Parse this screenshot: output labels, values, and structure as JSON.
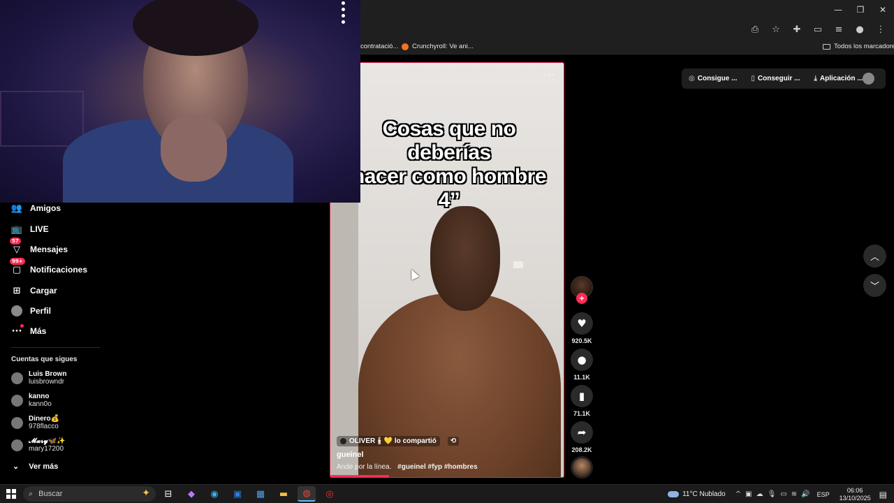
{
  "browser": {
    "bookmarks": {
      "item1": "contratació...",
      "item2": "Crunchyroll: Ve ani...",
      "all_label": "Todos los marcadores"
    }
  },
  "sidebar": {
    "nav": [
      {
        "label": "Amigos",
        "icon": "friends-icon"
      },
      {
        "label": "LIVE",
        "icon": "live-icon"
      },
      {
        "label": "Mensajes",
        "icon": "messages-icon",
        "badge": "57"
      },
      {
        "label": "Notificaciones",
        "icon": "notifications-icon",
        "badge": "99+"
      },
      {
        "label": "Cargar",
        "icon": "upload-icon"
      },
      {
        "label": "Perfil",
        "icon": "profile-avatar"
      },
      {
        "label": "Más",
        "icon": "more-icon"
      }
    ],
    "following_title": "Cuentas que sigues",
    "following": [
      {
        "name": "Luis Brown",
        "handle": "luisbrowndr"
      },
      {
        "name": "kanno",
        "handle": "kann0o"
      },
      {
        "name": "Dinero💰",
        "handle": "978flacco"
      },
      {
        "name": "𝓜𝓪𝓻𝔂🦋✨",
        "handle": "mary17200"
      }
    ],
    "see_more": "Ver más"
  },
  "header": {
    "coins": "Consigue ...",
    "app": "Conseguir ...",
    "desktop": "Aplicación ..."
  },
  "video": {
    "caption_line1": "Cosas que no deberías",
    "caption_line2": "hacer como hombre 4”",
    "shared_by": "OLIVER🕯️💛 lo compartió",
    "author": "gueinel",
    "description": "Ande por la línea.",
    "hashtags": "#gueinel  #fyp  #hombres",
    "progress": 0.25
  },
  "actions": {
    "likes": "920.5K",
    "comments": "11.1K",
    "saves": "71.1K",
    "shares": "208.2K"
  },
  "taskbar": {
    "search_placeholder": "Buscar",
    "weather": "11°C  Nublado",
    "lang": "ESP",
    "time": "06:06",
    "date": "13/10/2025"
  },
  "colors": {
    "accent": "#fe2c55"
  }
}
